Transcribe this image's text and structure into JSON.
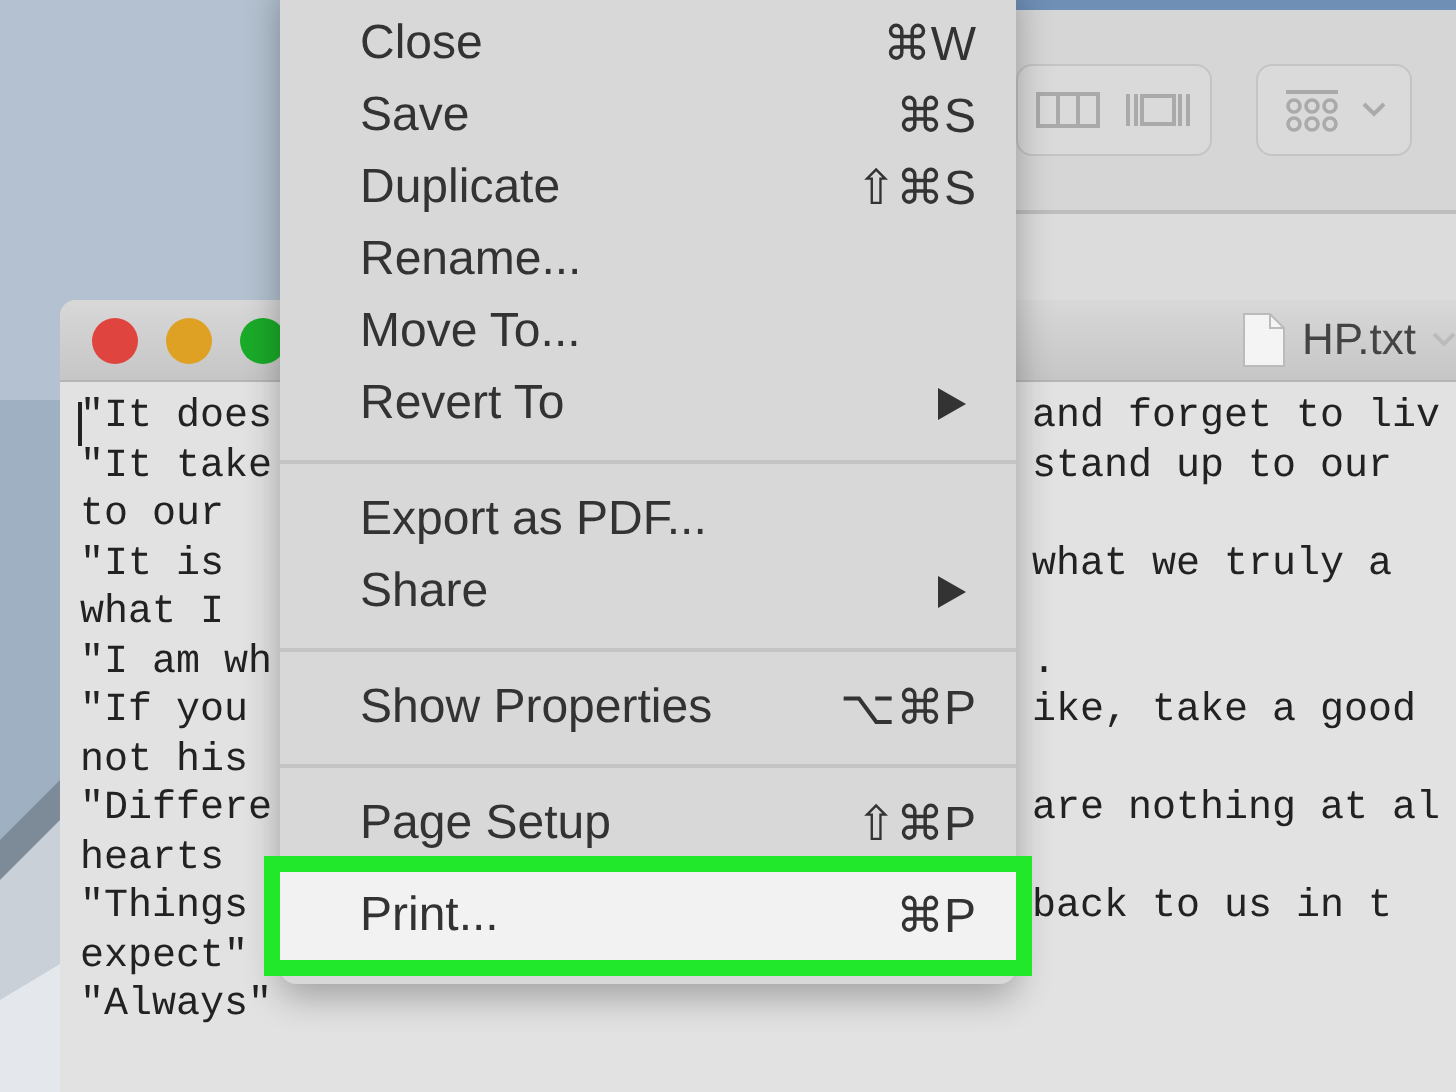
{
  "editor": {
    "title": "HP.txt",
    "lines": [
      {
        "left": "\"It does",
        "right": "and forget to liv"
      },
      {
        "left": "\"It take",
        "right": "stand up to our"
      },
      {
        "left": "to our"
      },
      {
        "left": "\"It is",
        "right": "what we truly a"
      },
      {
        "left": "what I"
      },
      {
        "left": "\"I am wh",
        "right": "."
      },
      {
        "left": "\"If you",
        "right": "ike, take a good"
      },
      {
        "left": "not his"
      },
      {
        "left": "\"Differe",
        "right": "are nothing at al"
      },
      {
        "left": "hearts"
      },
      {
        "left": "\"Things",
        "right": "back to us in t"
      },
      {
        "left": "expect\""
      },
      {
        "left": "\"Always\""
      }
    ]
  },
  "menu": {
    "items": [
      {
        "kind": "item",
        "label": "Close",
        "shortcut": "⌘W",
        "submenu": false,
        "highlighted": false
      },
      {
        "kind": "item",
        "label": "Save",
        "shortcut": "⌘S",
        "submenu": false,
        "highlighted": false
      },
      {
        "kind": "item",
        "label": "Duplicate",
        "shortcut": "⇧⌘S",
        "submenu": false,
        "highlighted": false
      },
      {
        "kind": "item",
        "label": "Rename...",
        "submenu": false,
        "highlighted": false
      },
      {
        "kind": "item",
        "label": "Move To...",
        "submenu": false,
        "highlighted": false
      },
      {
        "kind": "item",
        "label": "Revert To",
        "submenu": true,
        "highlighted": false
      },
      {
        "kind": "separator"
      },
      {
        "kind": "item",
        "label": "Export as PDF...",
        "submenu": false,
        "highlighted": false
      },
      {
        "kind": "item",
        "label": "Share",
        "submenu": true,
        "highlighted": false
      },
      {
        "kind": "separator"
      },
      {
        "kind": "item",
        "label": "Show Properties",
        "shortcut": "⌥⌘P",
        "submenu": false,
        "highlighted": false
      },
      {
        "kind": "separator"
      },
      {
        "kind": "item",
        "label": "Page Setup",
        "shortcut": "⇧⌘P",
        "submenu": false,
        "highlighted": false
      },
      {
        "kind": "item",
        "label": "Print...",
        "shortcut": "⌘P",
        "submenu": false,
        "highlighted": true
      }
    ]
  }
}
